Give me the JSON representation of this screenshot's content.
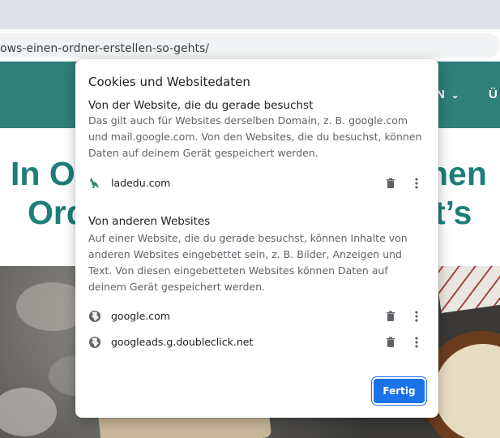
{
  "browser": {
    "url": "ows-einen-ordner-erstellen-so-gehts/"
  },
  "site_nav": {
    "item_partial_1": "N",
    "item_partial_2": "Ü",
    "color": "#2f8078"
  },
  "article": {
    "headline_line1_left": "In O",
    "headline_line1_right": "nen",
    "headline_line2_left": "Ord",
    "headline_line2_right": "t’s"
  },
  "dialog": {
    "title": "Cookies und Websitedaten",
    "first_party": {
      "heading": "Von der Website, die du gerade besuchst",
      "description": "Das gilt auch für Websites derselben Domain, z. B. google.com und mail.google.com. Von den Websites, die du besuchst, können Daten auf deinem Gerät gespeichert werden.",
      "sites": [
        {
          "name": "ladedu.com",
          "icon": "kangaroo-favicon"
        }
      ]
    },
    "third_party": {
      "heading": "Von anderen Websites",
      "description": "Auf einer Website, die du gerade besuchst, können Inhalte von anderen Websites eingebettet sein, z. B. Bilder, Anzeigen und Text. Von diesen eingebetteten Websites können Daten auf deinem Gerät gespeichert werden.",
      "sites": [
        {
          "name": "google.com",
          "icon": "globe-icon"
        },
        {
          "name": "googleads.g.doubleclick.net",
          "icon": "globe-icon"
        }
      ]
    },
    "done_label": "Fertig",
    "accent": "#1a73e8"
  }
}
